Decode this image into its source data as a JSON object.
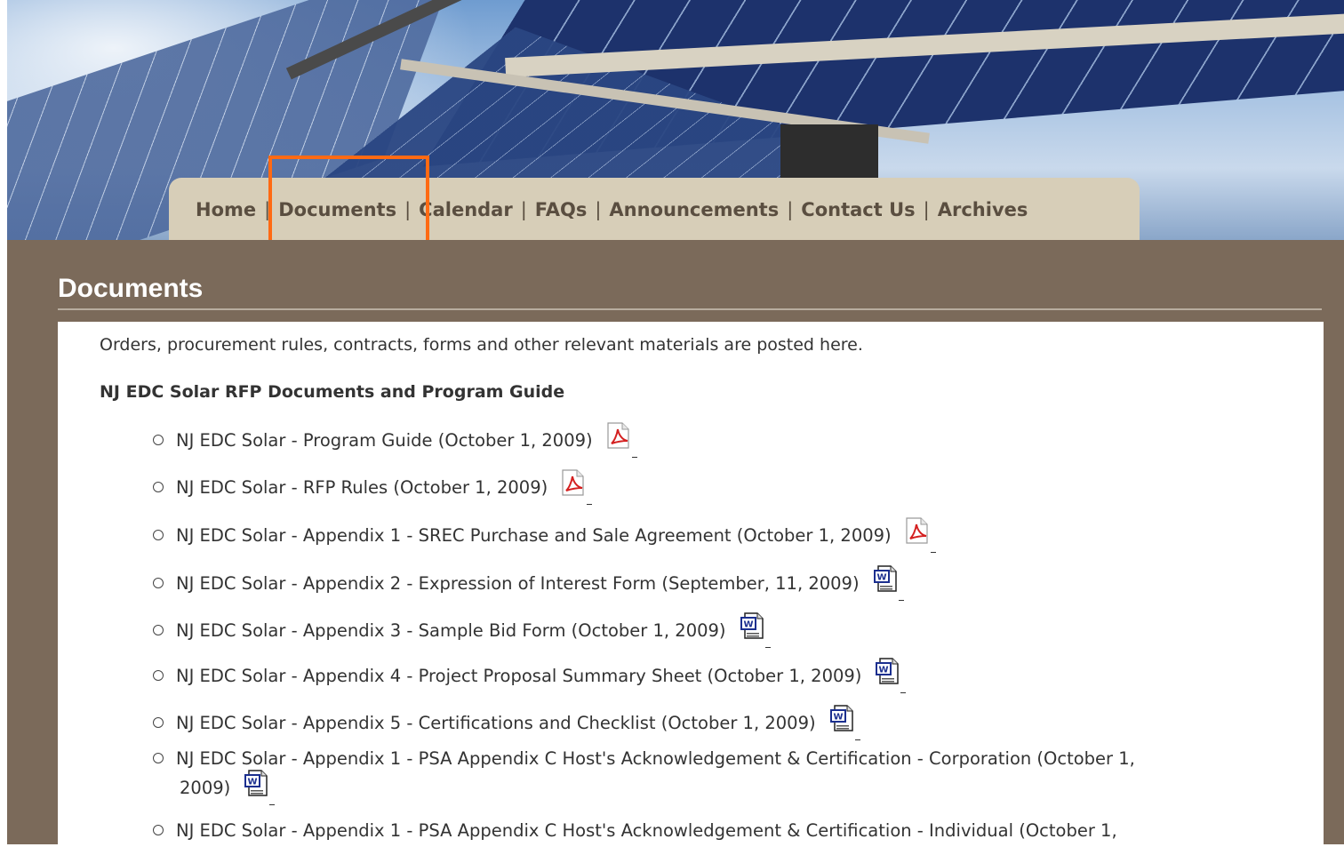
{
  "nav": {
    "items": [
      {
        "label": "Home"
      },
      {
        "label": "Documents"
      },
      {
        "label": "Calendar"
      },
      {
        "label": "FAQs"
      },
      {
        "label": "Announcements"
      },
      {
        "label": "Contact Us"
      },
      {
        "label": "Archives"
      }
    ],
    "separator": "|",
    "highlighted": "Documents",
    "highlight_color": "#ff6a13"
  },
  "page": {
    "title": "Documents",
    "intro": "Orders, procurement rules, contracts, forms and other relevant materials are posted here.",
    "section_heading": "NJ EDC Solar RFP Documents and Program Guide"
  },
  "documents": [
    {
      "text": "NJ EDC Solar - Program Guide (October 1, 2009)",
      "icon": "pdf-icon"
    },
    {
      "text": "NJ EDC Solar - RFP Rules (October 1, 2009)",
      "icon": "pdf-icon"
    },
    {
      "text": "NJ EDC Solar - Appendix 1 - SREC Purchase and Sale Agreement (October 1, 2009)",
      "icon": "pdf-icon"
    },
    {
      "text": "NJ EDC Solar - Appendix 2 - Expression of Interest Form (September, 11, 2009)",
      "icon": "word-icon"
    },
    {
      "text": "NJ EDC Solar - Appendix 3 - Sample Bid Form (October 1, 2009)",
      "icon": "word-icon"
    },
    {
      "text": "NJ EDC Solar - Appendix 4 - Project Proposal Summary Sheet (October 1, 2009)",
      "icon": "word-icon"
    },
    {
      "text": "NJ EDC Solar - Appendix 5 - Certifications and Checklist (October 1, 2009)",
      "icon": "word-icon"
    },
    {
      "text": "NJ EDC Solar - Appendix 1 - PSA Appendix C Host's Acknowledgement & Certification - Corporation (October 1,",
      "continuation": "2009)",
      "icon": "word-icon"
    },
    {
      "text": "NJ EDC Solar - Appendix 1 - PSA Appendix C Host's Acknowledgement & Certification - Individual (October 1,",
      "icon": "word-icon"
    }
  ],
  "colors": {
    "content_bg": "#7b6a5a",
    "nav_bg": "#d7ceb8",
    "nav_text": "#5a4e40",
    "pdf_red": "#d42020",
    "word_blue": "#1b2f8f"
  }
}
